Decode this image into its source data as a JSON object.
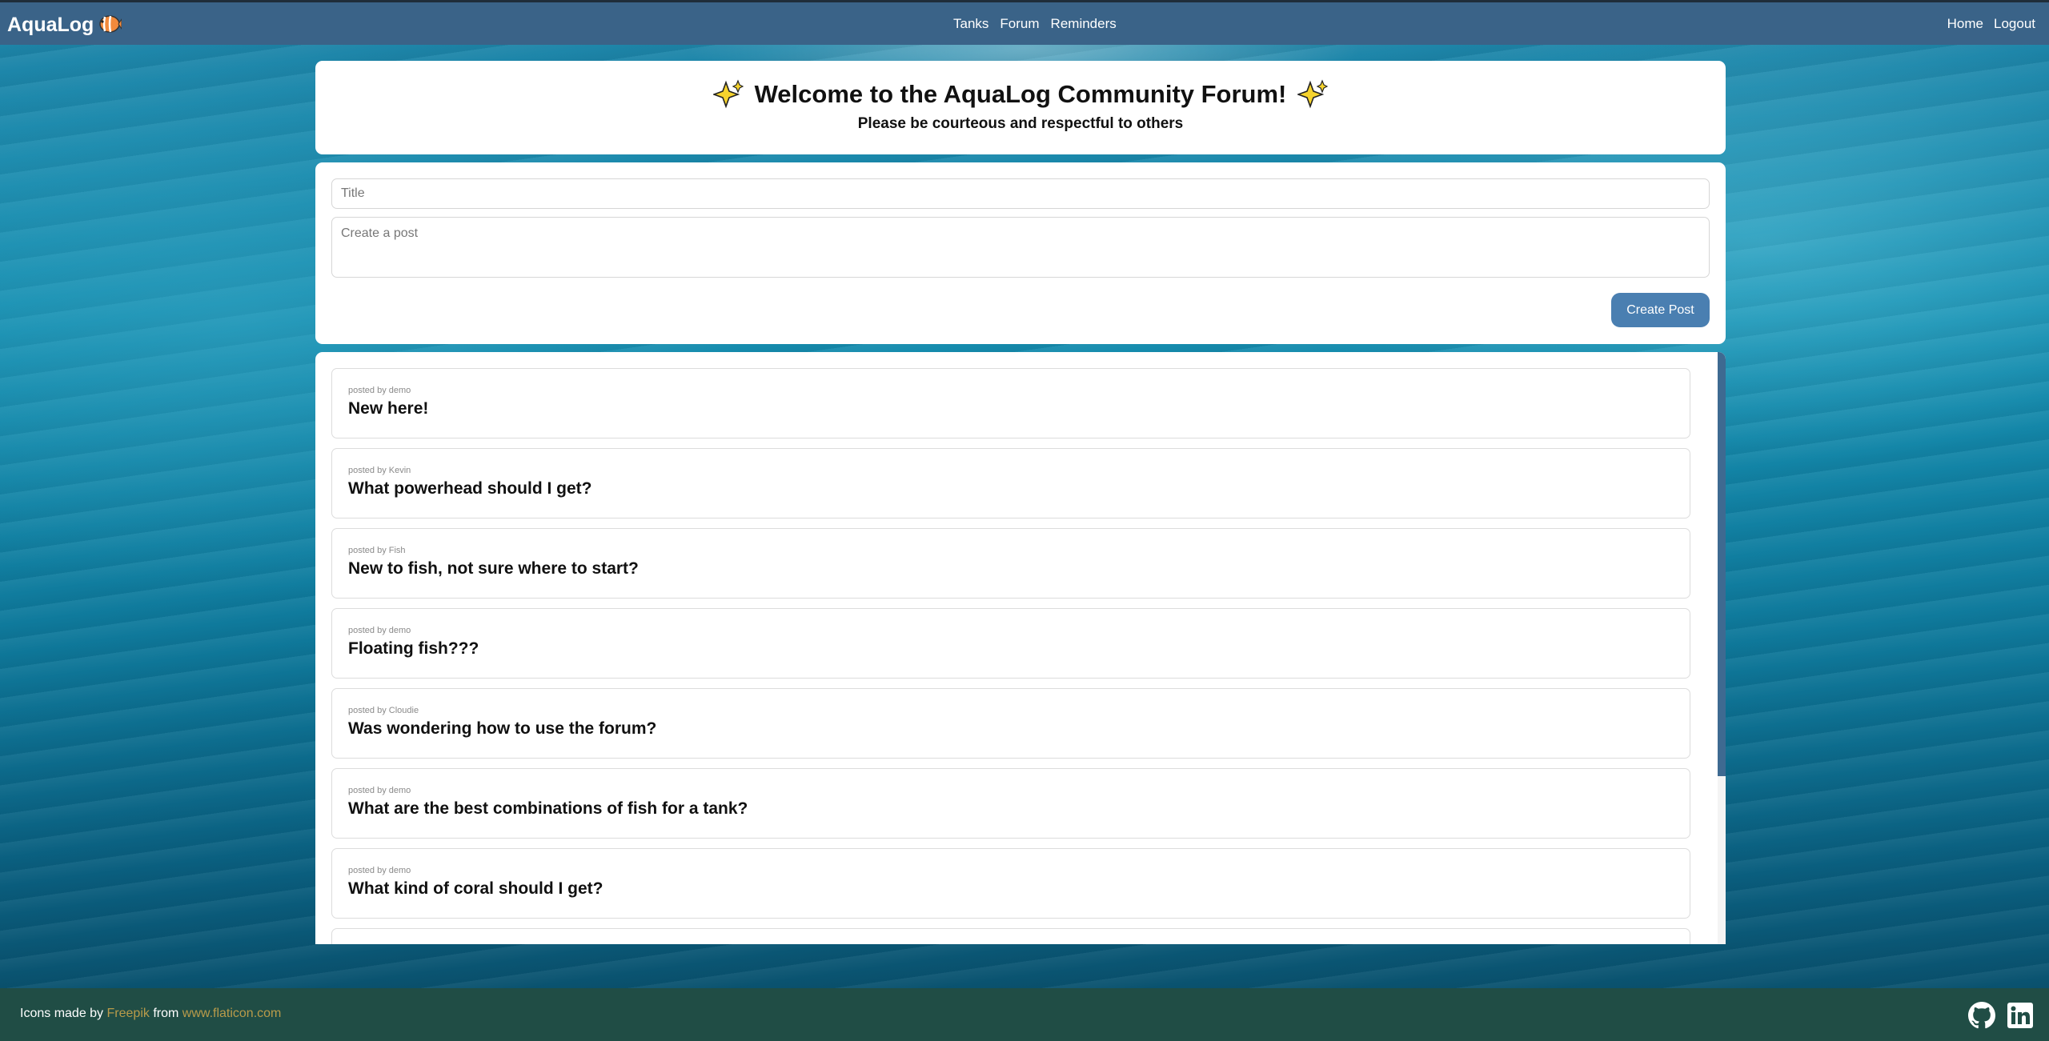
{
  "app": {
    "brand": "AquaLog",
    "brand_icon": "clownfish-icon"
  },
  "nav": {
    "center": [
      "Tanks",
      "Forum",
      "Reminders"
    ],
    "right": [
      "Home",
      "Logout"
    ]
  },
  "welcome": {
    "title": "Welcome to the AquaLog Community Forum!",
    "subtitle": "Please be courteous and respectful to others",
    "icon": "sparkles-icon"
  },
  "composer": {
    "title_placeholder": "Title",
    "body_placeholder": "Create a post",
    "submit_label": "Create Post"
  },
  "posts": [
    {
      "meta": "posted by demo",
      "title": "New here!"
    },
    {
      "meta": "posted by Kevin",
      "title": "What powerhead should I get?"
    },
    {
      "meta": "posted by Fish",
      "title": "New to fish, not sure where to start?"
    },
    {
      "meta": "posted by demo",
      "title": "Floating fish???"
    },
    {
      "meta": "posted by Cloudie",
      "title": "Was wondering how to use the forum?"
    },
    {
      "meta": "posted by demo",
      "title": "What are the best combinations of fish for a tank?"
    },
    {
      "meta": "posted by demo",
      "title": "What kind of coral should I get?"
    },
    {
      "meta": "",
      "title": ""
    }
  ],
  "footer": {
    "prefix": "Icons made by",
    "author": "Freepik",
    "middle": "from",
    "site": "www.flaticon.com",
    "icons": [
      "github-icon",
      "linkedin-icon"
    ]
  },
  "colors": {
    "navbar": "#3a6388",
    "button": "#4a7fb1",
    "footer": "#204d45",
    "footer_link": "#b99b4a",
    "scroll_thumb": "#3e6a91"
  }
}
